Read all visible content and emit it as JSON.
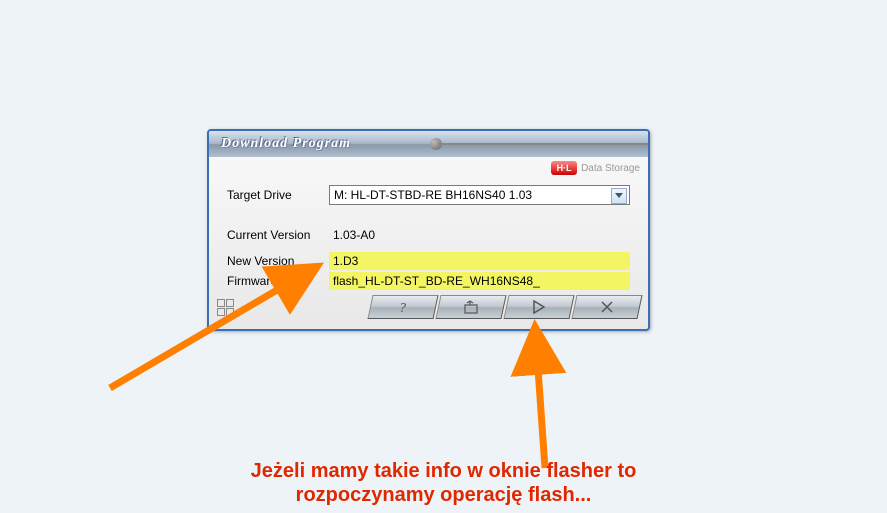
{
  "window": {
    "title": "Download  Program",
    "brand_logo_text": "H·L",
    "brand_text": "Data Storage"
  },
  "fields": {
    "target_drive_label": "Target Drive",
    "target_drive_value": "M: HL-DT-STBD-RE  BH16NS40 1.03",
    "current_version_label": "Current Version",
    "current_version_value": "1.03-A0",
    "new_version_label": "New Version",
    "new_version_value": "1.D3",
    "firmware_file_label": "Firmware File",
    "firmware_file_value": "flash_HL-DT-ST_BD-RE_WH16NS48_"
  },
  "buttons": {
    "help": "?",
    "browse": "browse-icon",
    "start": "play-icon",
    "cancel": "X"
  },
  "annotation": {
    "line1": "Jeżeli mamy takie info w oknie flasher to",
    "line2": "rozpoczynamy operację flash..."
  }
}
